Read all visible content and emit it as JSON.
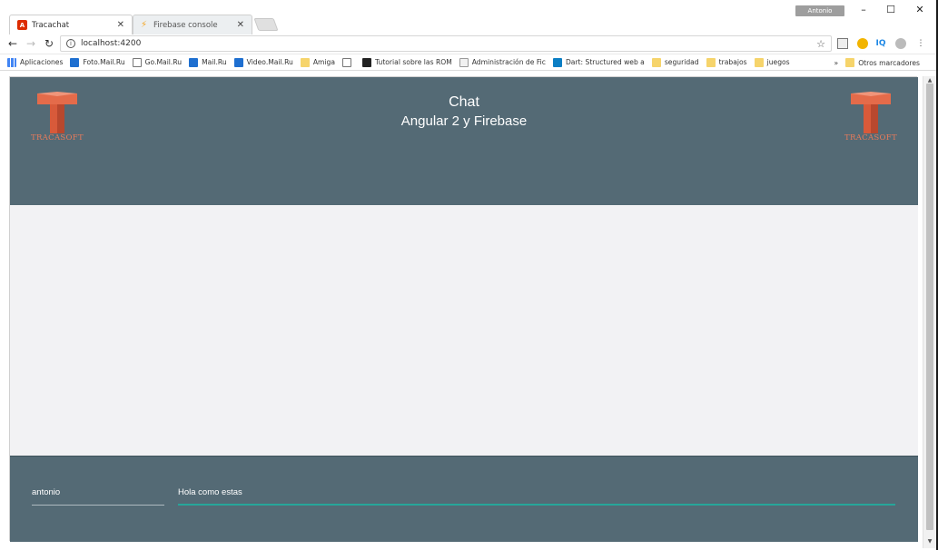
{
  "browser": {
    "tabs": [
      {
        "title": "Tracachat",
        "icon": "angular-icon",
        "close": "✕",
        "active": true
      },
      {
        "title": "Firebase console",
        "icon": "firebase-icon",
        "close": "✕",
        "active": false
      }
    ],
    "profile": "Antonio",
    "url": "localhost:4200",
    "bookmarks": [
      {
        "label": "Aplicaciones",
        "icon": "apps-icon"
      },
      {
        "label": "Foto.Mail.Ru",
        "icon": "mail-icon"
      },
      {
        "label": "Go.Mail.Ru",
        "icon": "page-icon"
      },
      {
        "label": "Mail.Ru",
        "icon": "mail-icon"
      },
      {
        "label": "Video.Mail.Ru",
        "icon": "mail-icon"
      },
      {
        "label": "Amiga",
        "icon": "folder-icon"
      },
      {
        "label": "",
        "icon": "page-icon"
      },
      {
        "label": "Tutorial sobre las ROM",
        "icon": "dark-icon"
      },
      {
        "label": "Administración de Fic",
        "icon": "admin-icon"
      },
      {
        "label": "Dart: Structured web a",
        "icon": "dart-icon"
      },
      {
        "label": "seguridad",
        "icon": "folder-icon"
      },
      {
        "label": "trabajos",
        "icon": "folder-icon"
      },
      {
        "label": "juegos",
        "icon": "folder-icon"
      }
    ],
    "bookmarks_overflow": "»",
    "other_bookmarks": "Otros marcadores"
  },
  "app": {
    "title": "Chat",
    "subtitle": "Angular 2 y Firebase",
    "logo_text": "TRACASOFT",
    "username": "antonio",
    "message": "Hola como estas"
  },
  "colors": {
    "header_bg": "#546a75",
    "accent": "#26a69a",
    "logo": "#e77b5b"
  }
}
